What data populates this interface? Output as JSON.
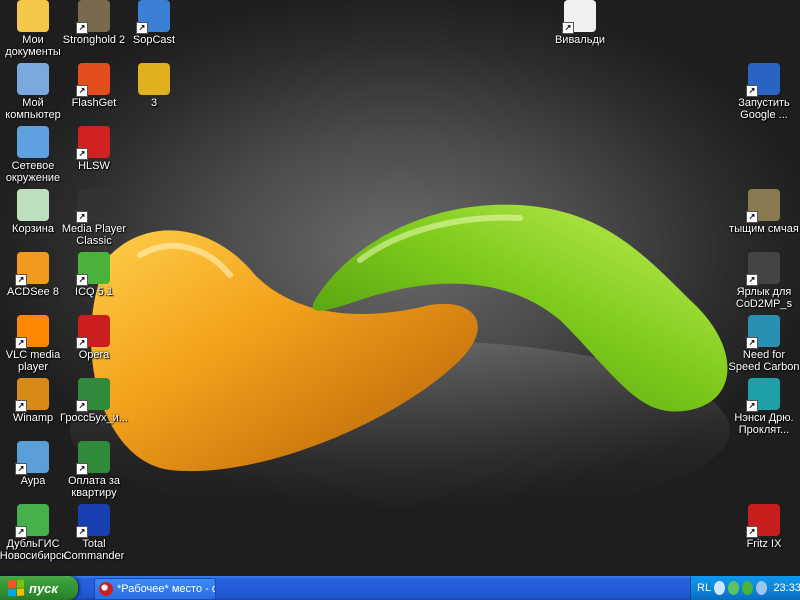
{
  "desktop": {
    "icons_left": [
      {
        "name": "my-documents",
        "label": "Мои документы",
        "glyph": "folder-icon",
        "color": "#f3c84a"
      },
      {
        "name": "my-computer",
        "label": "Мой компьютер",
        "glyph": "computer-icon",
        "color": "#7aa9e0"
      },
      {
        "name": "network",
        "label": "Сетевое окружение",
        "glyph": "network-icon",
        "color": "#5fa0de"
      },
      {
        "name": "recycle-bin",
        "label": "Корзина",
        "glyph": "recycle-bin-icon",
        "color": "#bfe0bf"
      },
      {
        "name": "acdsee",
        "label": "ACDSee 8",
        "glyph": "acdsee-icon",
        "color": "#f29a20"
      },
      {
        "name": "vlc",
        "label": "VLC media player",
        "glyph": "vlc-icon",
        "color": "#ff8800"
      },
      {
        "name": "winamp",
        "label": "Winamp",
        "glyph": "winamp-icon",
        "color": "#d78a18"
      },
      {
        "name": "aura",
        "label": "Аура",
        "glyph": "aura-icon",
        "color": "#5a9fd8"
      },
      {
        "name": "dubl-gis",
        "label": "ДубльГИС Новосибирск",
        "glyph": "gis-icon",
        "color": "#46b04a"
      }
    ],
    "icons_col2": [
      {
        "name": "stronghold",
        "label": "Stronghold 2",
        "glyph": "stronghold-icon",
        "color": "#7a6a4c"
      },
      {
        "name": "flashget",
        "label": "FlashGet",
        "glyph": "flashget-icon",
        "color": "#e34c1c"
      },
      {
        "name": "hlsw",
        "label": "HLSW",
        "glyph": "hlsw-icon",
        "color": "#d12222"
      },
      {
        "name": "mpc",
        "label": "Media Player Classic",
        "glyph": "mpc-icon",
        "color": "#333333"
      },
      {
        "name": "icq",
        "label": "ICQ 5.1",
        "glyph": "icq-icon",
        "color": "#48b23a"
      },
      {
        "name": "opera",
        "label": "Opera",
        "glyph": "opera-icon",
        "color": "#cc1e1e"
      },
      {
        "name": "grossbuh",
        "label": "ГроссБух_и...",
        "glyph": "excel-icon",
        "color": "#2f8a3b"
      },
      {
        "name": "oplata",
        "label": "Оплата за квартиру",
        "glyph": "excel-icon",
        "color": "#2f8a3b"
      },
      {
        "name": "total-commander",
        "label": "Total Commander",
        "glyph": "total-commander-icon",
        "color": "#1a3fb0"
      }
    ],
    "icons_col3": [
      {
        "name": "sopcast",
        "label": "SopCast",
        "glyph": "sopcast-icon",
        "color": "#3b7fd6"
      },
      {
        "name": "item-3",
        "label": "3",
        "glyph": "media-file-icon",
        "color": "#e0b020"
      }
    ],
    "icon_vivaldi": {
      "name": "vivaldi",
      "label": "Вивальди",
      "glyph": "document-icon",
      "color": "#f0f0f0"
    },
    "icons_right": [
      {
        "name": "google-earth",
        "label": "Запустить Google ...",
        "glyph": "google-earth-icon",
        "color": "#2b63c2"
      },
      {
        "name": "tyschim",
        "label": "тыщим смчая",
        "glyph": "game-icon",
        "color": "#8a7a50"
      },
      {
        "name": "cod2mp",
        "label": "Ярлык для CoD2MP_s",
        "glyph": "cod2-icon",
        "color": "#444444"
      },
      {
        "name": "nfs",
        "label": "Need for Speed Carbon",
        "glyph": "nfs-icon",
        "color": "#2a8fb0"
      },
      {
        "name": "nancy-drew",
        "label": "Нэнси Дрю. Проклят...",
        "glyph": "nancy-drew-icon",
        "color": "#1f9fa8"
      },
      {
        "name": "fritz",
        "label": "Fritz IX",
        "glyph": "fritz-icon",
        "color": "#c81e1e"
      }
    ]
  },
  "taskbar": {
    "start_label": "пуск",
    "task_label": "*Рабочее* место - о...",
    "tray": {
      "lang": "RL",
      "clock": "23:33"
    }
  },
  "colors": {
    "taskbar": "#245edc",
    "start": "#3a9e3a",
    "tray": "#0c82d9"
  }
}
